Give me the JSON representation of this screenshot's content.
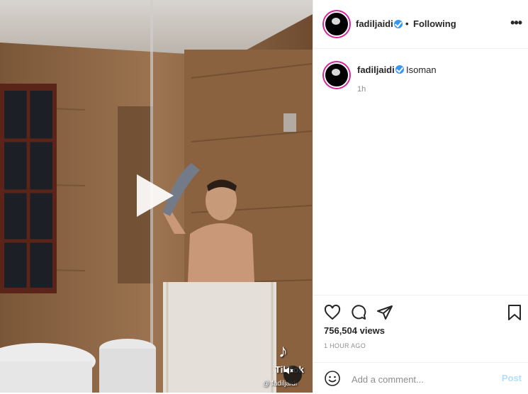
{
  "video": {
    "watermark_logo": "♪",
    "watermark_text": "TikTok",
    "watermark_handle": "@ fadiljaidi",
    "play_icon": "play-icon",
    "mute_icon": "muted-speaker-icon"
  },
  "header": {
    "username": "fadiljaidi",
    "separator": "•",
    "follow_status": "Following",
    "more_label": "•••"
  },
  "caption": {
    "username": "fadiljaidi",
    "text": "Isoman",
    "time": "1h"
  },
  "actions": {
    "like_icon": "heart-icon",
    "comment_icon": "comment-icon",
    "share_icon": "paper-plane-icon",
    "save_icon": "bookmark-icon",
    "views": "756,504 views",
    "posted": "1 HOUR AGO"
  },
  "comment": {
    "placeholder": "Add a comment...",
    "post_label": "Post",
    "emoji_icon": "smiley-icon"
  },
  "colors": {
    "verified": "#3897f0",
    "post_disabled": "#b2dffc",
    "story_ring": "#d6249f"
  }
}
